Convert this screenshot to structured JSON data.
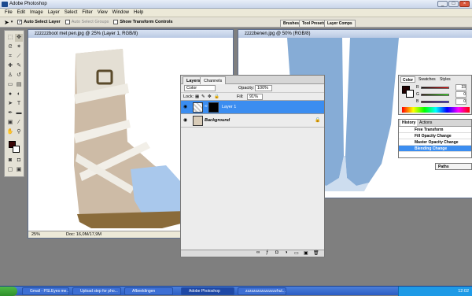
{
  "app": {
    "title": "Adobe Photoshop"
  },
  "menu": [
    "File",
    "Edit",
    "Image",
    "Layer",
    "Select",
    "Filter",
    "View",
    "Window",
    "Help"
  ],
  "options_bar": {
    "auto_select": "Auto Select Layer",
    "auto_select_groups": "Auto Select Groups",
    "show_transform": "Show Transform Controls"
  },
  "panel_tabs": [
    "Brushes",
    "Tool Presets",
    "Layer Comps"
  ],
  "doc1": {
    "title": "zzzzzzboot met pen.jpg @ 25% (Layer 1, RGB/8)",
    "zoom": "25%",
    "doc_info": "Doc: 16,0M/17,9M"
  },
  "doc2": {
    "title": "zzzzbenen.jpg @ 50% (RGB/8)"
  },
  "layers": {
    "tabs": [
      "Layers",
      "Channels"
    ],
    "blend_mode": "Color",
    "opacity_label": "Opacity:",
    "opacity": "100%",
    "lock_label": "Lock:",
    "fill_label": "Fill:",
    "fill": "91%",
    "items": [
      {
        "name": "Layer 1"
      },
      {
        "name": "Background"
      }
    ]
  },
  "color": {
    "tabs": [
      "Color",
      "Swatches",
      "Styles"
    ],
    "r": "33",
    "g": "0",
    "b": "0",
    "r_label": "R",
    "g_label": "G",
    "b_label": "B"
  },
  "history": {
    "tabs": [
      "History",
      "Actions"
    ],
    "items": [
      "Free Transform",
      "Fill Opacity Change",
      "Master Opacity Change",
      "Blending Change"
    ]
  },
  "paths": {
    "label": "Paths"
  },
  "taskbar": {
    "items": [
      "Gmail - PSLEyes me...",
      "Upload step for pho...",
      "Afbeeldingen",
      "Adobe Photoshop",
      "zzzzzzzzzzzzzzzzhul..."
    ],
    "clock": "12:02"
  },
  "colors": {
    "selected_layer": "#3b8df0",
    "taskbar": "#2a5cc4",
    "jeans": "#86acd6",
    "boot_knit": "#cdbba6"
  }
}
